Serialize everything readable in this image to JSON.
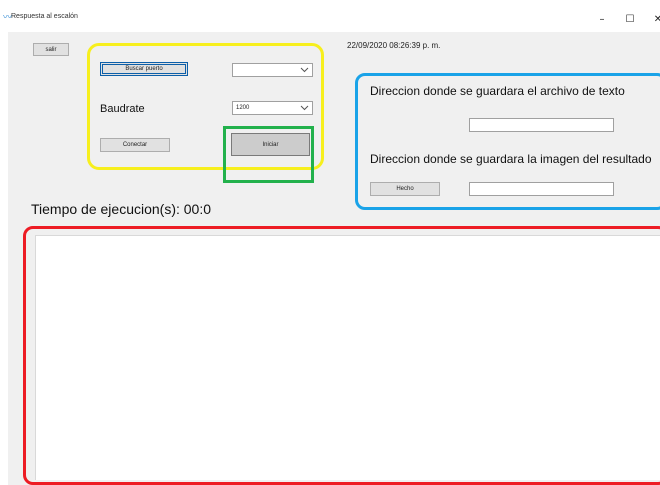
{
  "window": {
    "title": "Respuesta al escalón",
    "minimize_glyph": "–",
    "maximize_glyph": "☐",
    "close_glyph": "✕",
    "app_icon": "waveform-icon"
  },
  "controls": {
    "salir_label": "salir",
    "timestamp": "22/09/2020 08:26:39 p. m.",
    "buscar_puerto_label": "Buscar puerto",
    "port_combo_value": "",
    "baudrate_label": "Baudrate",
    "baudrate_value": "1200",
    "conectar_label": "Conectar",
    "iniciar_label": "Iniciar",
    "tiempo_label": "Tiempo de ejecucion(s): 00:0",
    "dir_texto_label": "Direccion donde se guardara el archivo de texto",
    "dir_imagen_label": "Direccion donde se guardara la imagen del resultado",
    "hecho_label": "Hecho",
    "dir_texto_value": "",
    "dir_imagen_value": ""
  },
  "highlight_colors": {
    "yellow": "#f7ef1d",
    "green": "#22b14c",
    "blue": "#1aa3e8",
    "red": "#ed1c24"
  }
}
